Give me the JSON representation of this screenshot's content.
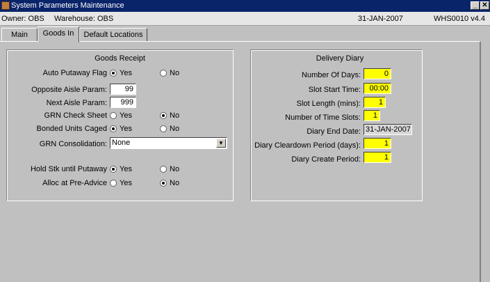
{
  "window": {
    "title": "System Parameters Maintenance"
  },
  "info": {
    "owner": "Owner: OBS",
    "warehouse": "Warehouse: OBS",
    "date": "31-JAN-2007",
    "module": "WHS0010 v4.4"
  },
  "tabs": [
    "Main",
    "Goods In",
    "Default Locations"
  ],
  "goods_receipt": {
    "title": "Goods Receipt",
    "yes": "Yes",
    "no": "No",
    "auto_putaway_label": "Auto Putaway Flag",
    "auto_putaway_selected": "Yes",
    "opposite_aisle_label": "Opposite Aisle Param:",
    "opposite_aisle_value": "99",
    "next_aisle_label": "Next Aisle Param:",
    "next_aisle_value": "999",
    "grn_check_label": "GRN Check Sheet",
    "grn_check_selected": "No",
    "bonded_label": "Bonded Units Caged",
    "bonded_selected": "Yes",
    "grn_consolidation_label": "GRN Consolidation:",
    "grn_consolidation_value": "None",
    "hold_stk_label": "Hold Stk until Putaway",
    "hold_stk_selected": "Yes",
    "alloc_label": "Alloc at Pre-Advice",
    "alloc_selected": "No"
  },
  "delivery_diary": {
    "title": "Delivery Diary",
    "num_days_label": "Number Of Days:",
    "num_days_value": "0",
    "slot_start_label": "Slot Start Time:",
    "slot_start_value": "00:00",
    "slot_length_label": "Slot Length (mins):",
    "slot_length_value": "1",
    "num_slots_label": "Number of Time Slots:",
    "num_slots_value": "1",
    "end_date_label": "Diary End Date:",
    "end_date_value": "31-JAN-2007",
    "cleardown_label": "Diary Cleardown Period (days):",
    "cleardown_value": "1",
    "create_label": "Diary Create Period:",
    "create_value": "1"
  }
}
